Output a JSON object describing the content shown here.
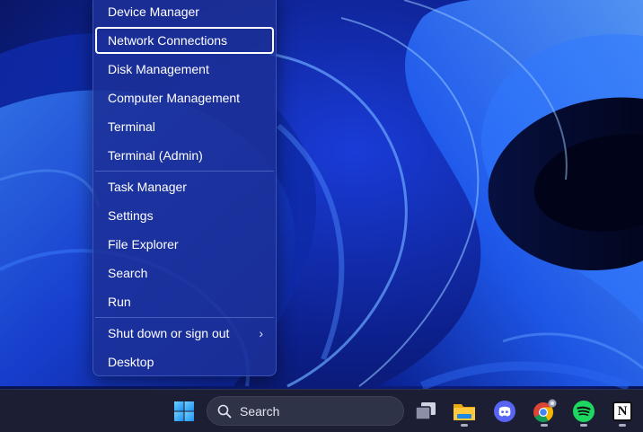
{
  "menu": {
    "items": [
      {
        "label": "Device Manager"
      },
      {
        "label": "Network Connections",
        "focused": true
      },
      {
        "label": "Disk Management"
      },
      {
        "label": "Computer Management"
      },
      {
        "label": "Terminal"
      },
      {
        "label": "Terminal (Admin)"
      },
      {
        "label": "Task Manager"
      },
      {
        "label": "Settings"
      },
      {
        "label": "File Explorer"
      },
      {
        "label": "Search"
      },
      {
        "label": "Run"
      },
      {
        "label": "Shut down or sign out",
        "submenu": true
      },
      {
        "label": "Desktop"
      }
    ],
    "submenu_glyph": "›"
  },
  "taskbar": {
    "search": {
      "placeholder": "Search",
      "icon": "search-icon"
    },
    "icons": [
      {
        "name": "windows-start-icon",
        "running": false
      },
      {
        "name": "task-view-icon",
        "running": false
      },
      {
        "name": "file-explorer-icon",
        "running": true
      },
      {
        "name": "discord-icon",
        "running": false
      },
      {
        "name": "chrome-icon",
        "running": true
      },
      {
        "name": "spotify-icon",
        "running": true
      },
      {
        "name": "notion-icon",
        "running": true
      }
    ],
    "notion_glyph": "N"
  },
  "colors": {
    "wallpaper_dark": "#06124a",
    "wallpaper_bright": "#1f6bff",
    "menu_bg": "#1c3096",
    "taskbar_bg": "#1c1f33",
    "discord": "#5865f2",
    "spotify": "#1ed760"
  }
}
